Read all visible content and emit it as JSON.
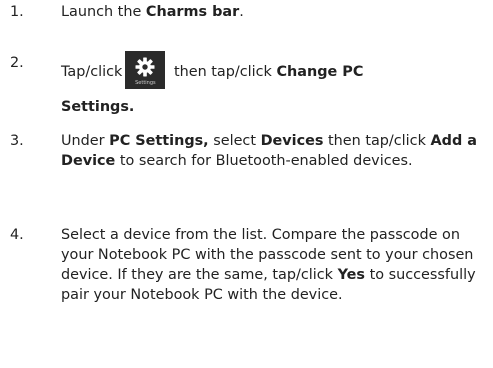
{
  "steps": [
    {
      "num": "1.",
      "parts": [
        "Launch the ",
        "Charms bar",
        "."
      ]
    },
    {
      "num": "2.",
      "pre": "Tap/click",
      "icon_name": "settings-gear-icon",
      "icon_caption": "Settings",
      "post": " then tap/click ",
      "bold1": "Change PC",
      "bold2": "Settings."
    },
    {
      "num": "3.",
      "parts": [
        "Under ",
        "PC Settings,",
        " select ",
        "Devices",
        " then tap/click ",
        "Add a Device",
        " to search for Bluetooth-enabled devices."
      ]
    },
    {
      "num": "4.",
      "parts": [
        "Select a device from the list. Compare the passcode on your Notebook PC with the passcode sent to your chosen device. If they are the same, tap/click ",
        "Yes",
        " to successfully pair your Notebook PC with the device."
      ]
    }
  ]
}
